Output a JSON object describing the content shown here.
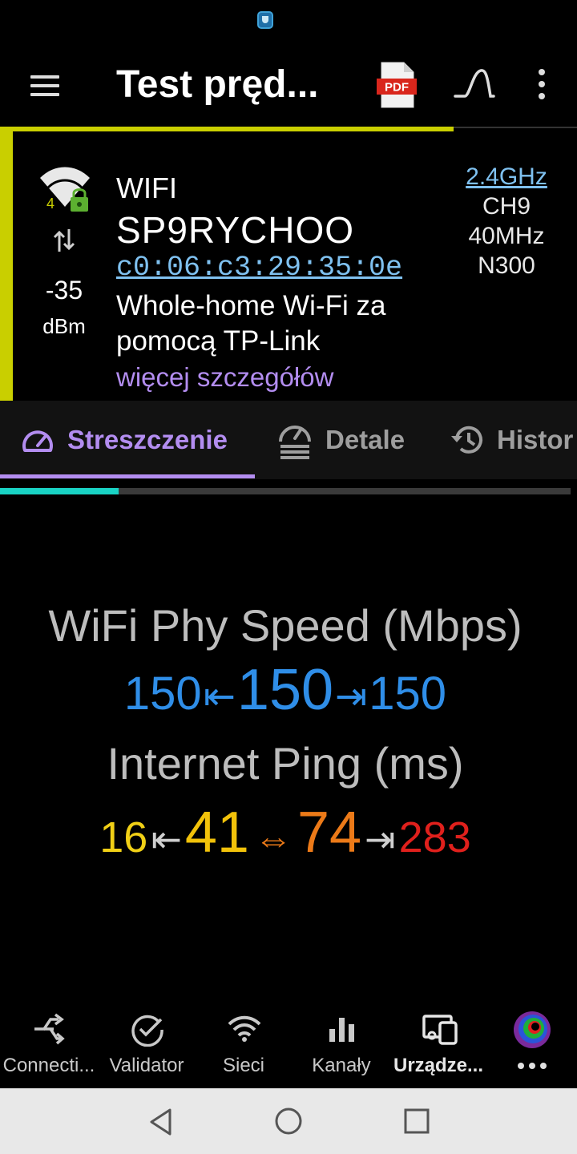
{
  "app_bar": {
    "title": "Test pręd...",
    "pdf_label": "PDF"
  },
  "network": {
    "type": "WIFI",
    "ssid": "SP9RYCHOO",
    "bssid": "c0:06:c3:29:35:0e",
    "vendor": "Whole-home Wi-Fi za pomocą TP-Link",
    "more_details": "więcej szczegółów",
    "wifi_standard_badge": "4",
    "rssi": "-35",
    "rssi_unit": "dBm",
    "band": "2.4GHz",
    "channel": "CH9",
    "width": "40MHz",
    "rate": "N300"
  },
  "tabs": [
    {
      "label": "Streszczenie",
      "active": true
    },
    {
      "label": "Detale",
      "active": false
    },
    {
      "label": "Histor",
      "active": false
    }
  ],
  "progress": {
    "fraction": 0.208
  },
  "phy_speed": {
    "label": "WiFi Phy Speed (Mbps)",
    "rx": "150",
    "current": "150",
    "tx": "150"
  },
  "ping": {
    "label": "Internet Ping (ms)",
    "min": "16",
    "p25": "41",
    "p75": "74",
    "max": "283"
  },
  "bottom_nav": [
    {
      "label": "Connecti...",
      "icon": "connectivity-icon"
    },
    {
      "label": "Validator",
      "icon": "check-circle-icon"
    },
    {
      "label": "Sieci",
      "icon": "wifi-icon"
    },
    {
      "label": "Kanały",
      "icon": "bar-chart-icon"
    },
    {
      "label": "Urządze...",
      "icon": "devices-icon",
      "active": true
    }
  ],
  "colors": {
    "accent_purple": "#b38df0",
    "signal_yellow": "#c9cf00",
    "speed_blue": "#2f8ee8",
    "link_blue": "#7fc1f0",
    "progress_teal": "#19d3c5"
  }
}
